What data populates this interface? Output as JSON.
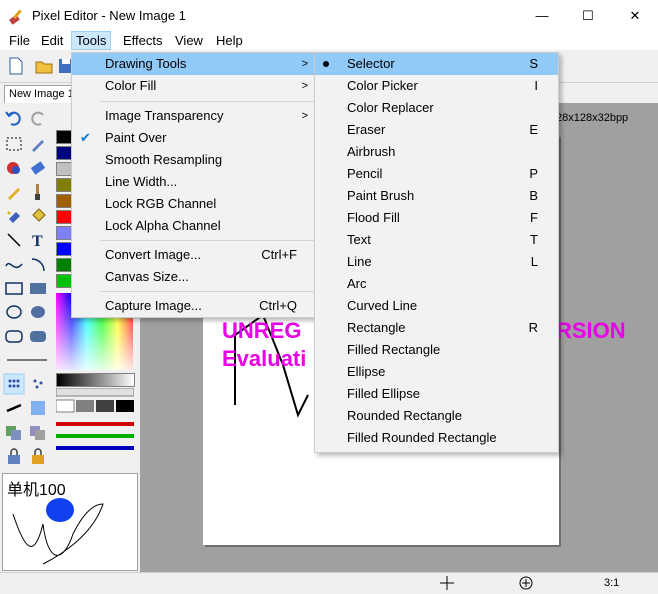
{
  "window": {
    "title": "Pixel Editor - New Image 1",
    "minimize": "—",
    "maximize": "☐",
    "close": "✕"
  },
  "menubar": [
    "File",
    "Edit",
    "Tools",
    "Effects",
    "View",
    "Help"
  ],
  "document": {
    "tab": "New Image 1",
    "info": "28x128x32bpp"
  },
  "tools_menu": {
    "items": [
      {
        "label": "Drawing Tools",
        "submenu": true,
        "highlighted": true
      },
      {
        "label": "Color Fill",
        "submenu": true
      },
      {
        "label": "Image Transparency",
        "submenu": true
      },
      {
        "label": "Paint Over",
        "checked": true
      },
      {
        "label": "Smooth Resampling"
      },
      {
        "label": "Line Width..."
      },
      {
        "label": "Lock RGB Channel"
      },
      {
        "label": "Lock Alpha Channel"
      },
      {
        "label": "Convert Image...",
        "shortcut": "Ctrl+F"
      },
      {
        "label": "Canvas Size..."
      },
      {
        "label": "Capture Image...",
        "shortcut": "Ctrl+Q"
      }
    ]
  },
  "drawing_tools_menu": {
    "items": [
      {
        "label": "Selector",
        "shortcut": "S",
        "selected": true
      },
      {
        "label": "Color Picker",
        "shortcut": "I"
      },
      {
        "label": "Color Replacer",
        "shortcut": ""
      },
      {
        "label": "Eraser",
        "shortcut": "E"
      },
      {
        "label": "Airbrush",
        "shortcut": ""
      },
      {
        "label": "Pencil",
        "shortcut": "P"
      },
      {
        "label": "Paint Brush",
        "shortcut": "B"
      },
      {
        "label": "Flood Fill",
        "shortcut": "F"
      },
      {
        "label": "Text",
        "shortcut": "T"
      },
      {
        "label": "Line",
        "shortcut": "L"
      },
      {
        "label": "Arc",
        "shortcut": ""
      },
      {
        "label": "Curved Line",
        "shortcut": ""
      },
      {
        "label": "Rectangle",
        "shortcut": "R"
      },
      {
        "label": "Filled Rectangle",
        "shortcut": ""
      },
      {
        "label": "Ellipse",
        "shortcut": ""
      },
      {
        "label": "Filled Ellipse",
        "shortcut": ""
      },
      {
        "label": "Rounded Rectangle",
        "shortcut": ""
      },
      {
        "label": "Filled Rounded Rectangle",
        "shortcut": ""
      }
    ]
  },
  "watermark": {
    "line1_start": "UNREG",
    "line1_end": "RSION",
    "line2": "Evaluati"
  },
  "preview": {
    "label": "单机100"
  },
  "status": {
    "zoom": "3:1"
  },
  "palette_colors": [
    "#000000",
    "#000080",
    "#808080",
    "#800000",
    "#c0c0c0",
    "#808000",
    "#ff0000",
    "#8080ff",
    "#0000ff",
    "#008000",
    "#00ff00",
    "#ffffff"
  ],
  "colors": {
    "menu_highlight": "#91c9f7",
    "watermark": "#e800e8"
  }
}
